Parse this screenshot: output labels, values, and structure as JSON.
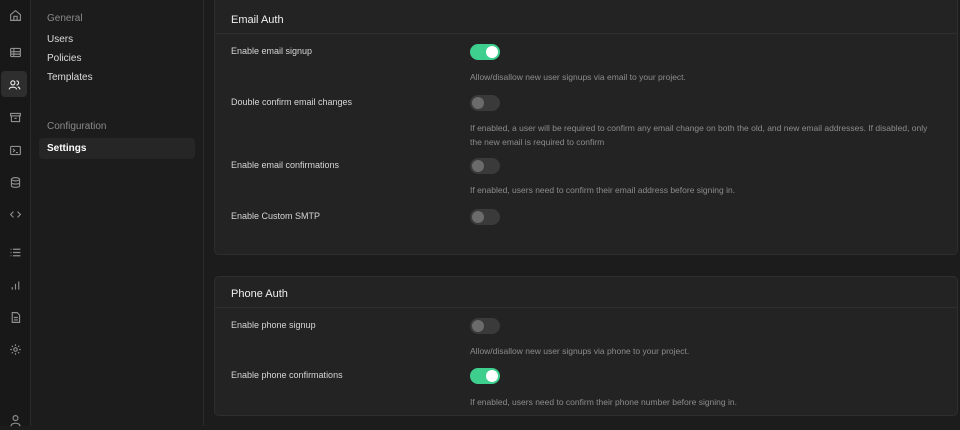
{
  "rail": {
    "icons": [
      "home-icon",
      "table-icon",
      "users-icon",
      "archive-icon",
      "terminal-icon",
      "database-icon",
      "code-icon",
      "list-icon",
      "bar-chart-icon",
      "document-icon",
      "gear-icon",
      "user-icon"
    ]
  },
  "nav": {
    "general_heading": "General",
    "general_items": [
      "Users",
      "Policies",
      "Templates"
    ],
    "config_heading": "Configuration",
    "settings_label": "Settings"
  },
  "email_auth": {
    "title": "Email Auth",
    "rows": [
      {
        "label": "Enable email signup",
        "enabled": true,
        "description": "Allow/disallow new user signups via email to your project."
      },
      {
        "label": "Double confirm email changes",
        "enabled": false,
        "description": "If enabled, a user will be required to confirm any email change on both the old, and new email addresses. If disabled, only the new email is required to confirm"
      },
      {
        "label": "Enable email confirmations",
        "enabled": false,
        "description": "If enabled, users need to confirm their email address before signing in."
      },
      {
        "label": "Enable Custom SMTP",
        "enabled": false,
        "description": ""
      }
    ]
  },
  "phone_auth": {
    "title": "Phone Auth",
    "rows": [
      {
        "label": "Enable phone signup",
        "enabled": false,
        "description": "Allow/disallow new user signups via phone to your project."
      },
      {
        "label": "Enable phone confirmations",
        "enabled": true,
        "description": "If enabled, users need to confirm their phone number before signing in."
      }
    ]
  },
  "colors": {
    "accent": "#3ecf8e",
    "background": "#1c1c1c",
    "card": "#232323"
  }
}
